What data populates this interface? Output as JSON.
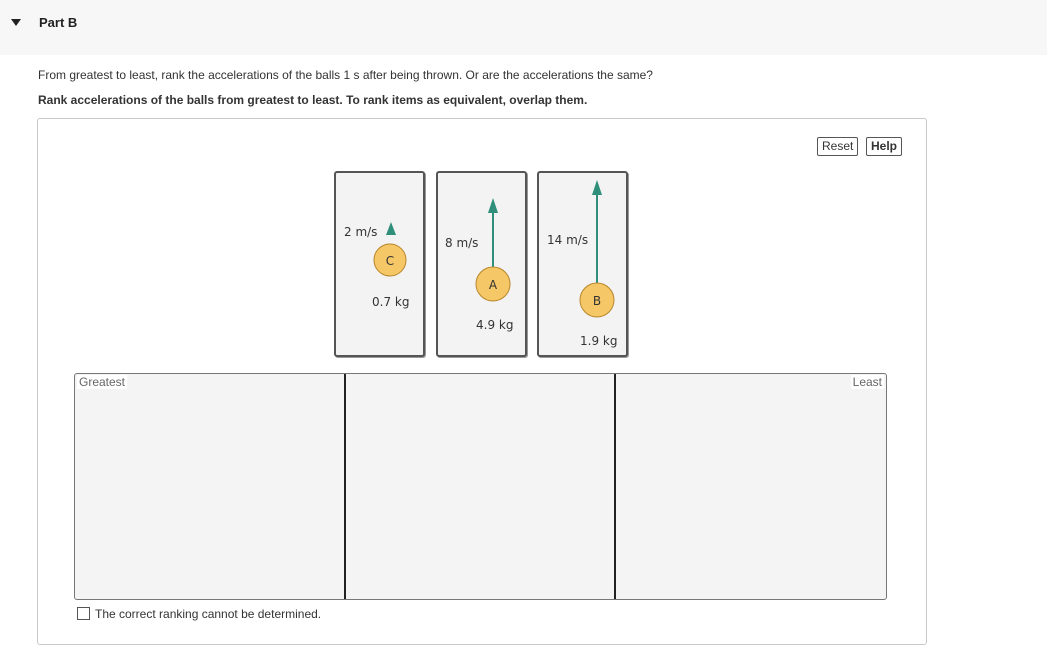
{
  "header": {
    "part_title": "Part B"
  },
  "question": "From greatest to least, rank the accelerations of the balls 1 s after being thrown. Or are the accelerations the same?",
  "instruction": "Rank accelerations of the balls from greatest to least. To rank items as equivalent, overlap them.",
  "toolbar": {
    "reset_label": "Reset",
    "help_label": "Help"
  },
  "tiles": [
    {
      "ball": "C",
      "speed": "2 m/s",
      "mass": "0.7 kg"
    },
    {
      "ball": "A",
      "speed": "8 m/s",
      "mass": "4.9 kg"
    },
    {
      "ball": "B",
      "speed": "14 m/s",
      "mass": "1.9 kg"
    }
  ],
  "ranking": {
    "greatest_label": "Greatest",
    "least_label": "Least"
  },
  "cannot_determine_label": "The correct ranking cannot be determined.",
  "colors": {
    "arrow": "#2f8f7a",
    "ball_fill": "#f5c766",
    "ball_edge": "#b8862b"
  }
}
